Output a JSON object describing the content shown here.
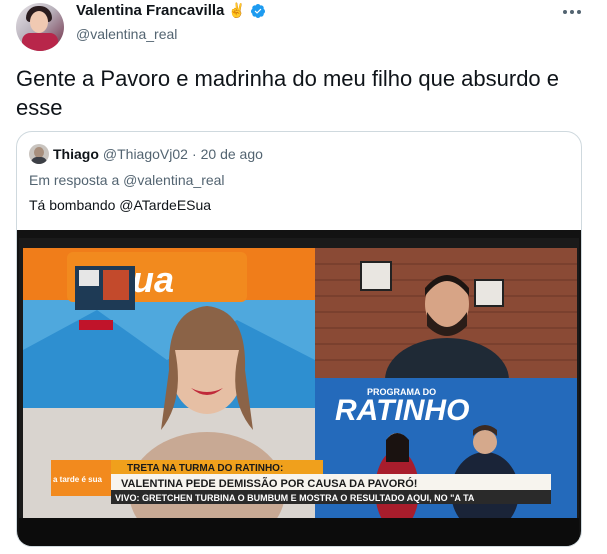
{
  "tweet": {
    "author_name": "Valentina Francavilla",
    "author_emoji": "✌️",
    "author_handle": "@valentina_real",
    "icons": {
      "verified": "verified-badge-icon",
      "more": "more-options-icon"
    },
    "text": "Gente a Pavoro e madrinha do meu filho que absurdo e esse"
  },
  "quoted": {
    "author_name": "Thiago",
    "author_handle": "@ThiagoVj02",
    "separator": "·",
    "date": "20 de ago",
    "reply_context": "Em resposta a @valentina_real",
    "text": "Tá bombando @ATardeESua",
    "media": {
      "logo_text": "sua",
      "program_title": "PROGRAMA DO",
      "program_name": "RATINHO",
      "banner_top": "TRETA NA TURMA DO RATINHO:",
      "banner_main": "VALENTINA PEDE DEMISSÃO POR CAUSA DA PAVORÓ!",
      "banner_ticker": "VIVO: GRETCHEN TURBINA O BUMBUM E MOSTRA O RESULTADO AQUI, NO \"A TA",
      "show_logo": "a tarde é sua",
      "colors": {
        "orange": "#f08a1c",
        "blue": "#3aa6e0",
        "ticker_bg": "#2a2a2a"
      }
    }
  },
  "colors": {
    "primary_text": "#0f1419",
    "secondary_text": "#536471",
    "verified_blue": "#1d9bf0",
    "border": "#cfd9de"
  }
}
